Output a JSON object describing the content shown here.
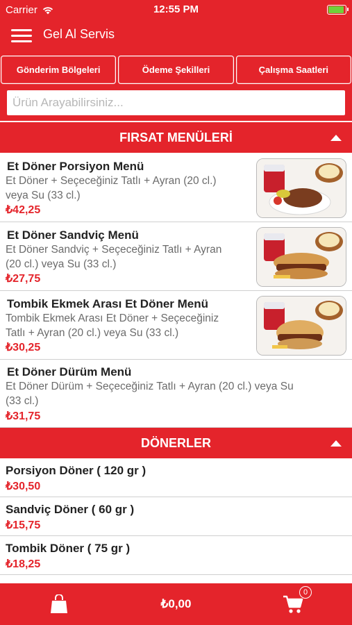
{
  "status_bar": {
    "carrier": "Carrier",
    "time": "12:55 PM"
  },
  "nav": {
    "title": "Gel Al Servis"
  },
  "tabs": [
    "Gönderim Bölgeleri",
    "Ödeme Şekilleri",
    "Çalışma Saatleri"
  ],
  "search": {
    "placeholder": "Ürün Arayabilirsiniz..."
  },
  "sections": [
    {
      "title": "FIRSAT MENÜLERİ",
      "items": [
        {
          "name": "Et Döner Porsiyon Menü",
          "desc_lines": [
            "Et Döner + Seçeceğiniz Tatlı + Ayran (20 cl.)",
            "veya Su (33 cl.)"
          ],
          "price": "₺42,25"
        },
        {
          "name": "Et Döner Sandviç Menü",
          "desc_lines": [
            "Et Döner Sandviç + Seçeceğiniz Tatlı + Ayran",
            "(20 cl.) veya Su (33 cl.)"
          ],
          "price": "₺27,75"
        },
        {
          "name": "Tombik Ekmek Arası Et Döner Menü",
          "desc_lines": [
            "Tombik Ekmek Arası Et Döner + Seçeceğiniz",
            "Tatlı + Ayran (20 cl.) veya Su (33 cl.)"
          ],
          "price": "₺30,25"
        },
        {
          "name": "Et Döner Dürüm Menü",
          "desc_lines": [
            "Et Döner Dürüm + Seçeceğiniz Tatlı + Ayran (20 cl.) veya Su",
            "(33 cl.)"
          ],
          "price": "₺31,75"
        }
      ]
    },
    {
      "title": "DÖNERLER",
      "items": [
        {
          "name": "Porsiyon Döner ( 120 gr )",
          "price": "₺30,50"
        },
        {
          "name": "Sandviç Döner ( 60 gr )",
          "price": "₺15,75"
        },
        {
          "name": "Tombik Döner ( 75 gr )",
          "price": "₺18,25"
        }
      ]
    }
  ],
  "bottom_bar": {
    "total": "₺0,00",
    "cart_count": "0"
  },
  "icons": {
    "menu": "hamburger-menu-icon",
    "bag": "shopping-bag-icon",
    "cart": "shopping-cart-icon",
    "collapse": "chevron-up-icon",
    "wifi": "wifi-icon",
    "battery": "battery-icon"
  },
  "colors": {
    "brand_red": "#e4242b",
    "price_red": "#e4242b",
    "desc_gray": "#6b6b6b",
    "battery_green": "#6fd13a"
  }
}
